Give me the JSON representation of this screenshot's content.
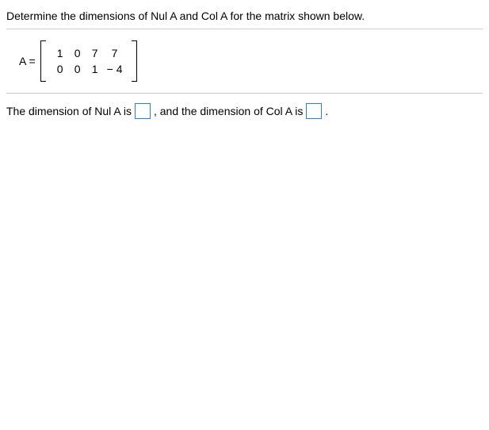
{
  "question": "Determine the dimensions of Nul A and Col A for the matrix shown below.",
  "matrix": {
    "label": "A =",
    "rows": [
      [
        "1",
        "0",
        "7",
        "7"
      ],
      [
        "0",
        "0",
        "1",
        "− 4"
      ]
    ]
  },
  "answer": {
    "part1": "The dimension of Nul A is",
    "part2": ", and the dimension of Col A is",
    "part3": "."
  }
}
